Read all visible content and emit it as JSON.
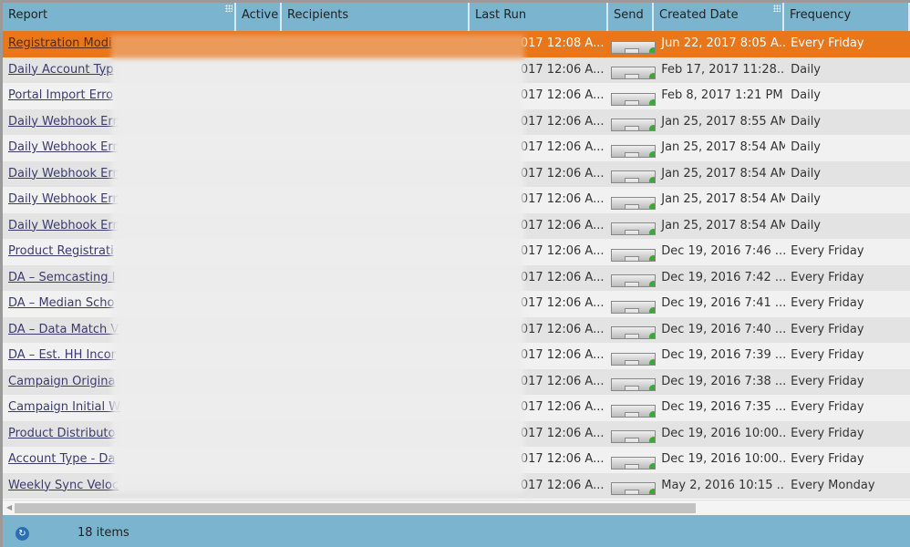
{
  "columns": [
    "Report",
    "Active",
    "Recipients",
    "Last Run",
    "Send",
    "Created Date",
    "Frequency"
  ],
  "rows": [
    {
      "report": "Registration Modi",
      "last_run": "017 12:08 A...",
      "created": "Jun 22, 2017 8:05 A...",
      "frequency": "Every Friday",
      "selected": true
    },
    {
      "report": "Daily Account Typ",
      "last_run": "017 12:06 A...",
      "created": "Feb 17, 2017 11:28...",
      "frequency": "Daily"
    },
    {
      "report": "Portal Import Erro",
      "last_run": "017 12:06 A...",
      "created": "Feb 8, 2017 1:21 PM",
      "frequency": "Daily"
    },
    {
      "report": "Daily Webhook Err",
      "last_run": "017 12:06 A...",
      "created": "Jan 25, 2017 8:55 AM",
      "frequency": "Daily"
    },
    {
      "report": "Daily Webhook Err",
      "last_run": "017 12:06 A...",
      "created": "Jan 25, 2017 8:54 AM",
      "frequency": "Daily"
    },
    {
      "report": "Daily Webhook Err",
      "last_run": "017 12:06 A...",
      "created": "Jan 25, 2017 8:54 AM",
      "frequency": "Daily"
    },
    {
      "report": "Daily Webhook Err",
      "last_run": "017 12:06 A...",
      "created": "Jan 25, 2017 8:54 AM",
      "frequency": "Daily"
    },
    {
      "report": "Daily Webhook Err",
      "last_run": "017 12:06 A...",
      "created": "Jan 25, 2017 8:54 AM",
      "frequency": "Daily"
    },
    {
      "report": "Product Registrati",
      "last_run": "017 12:06 A...",
      "created": "Dec 19, 2016 7:46 ...",
      "frequency": "Every Friday"
    },
    {
      "report": "DA – Semcasting I",
      "last_run": "017 12:06 A...",
      "created": "Dec 19, 2016 7:42 ...",
      "frequency": "Every Friday"
    },
    {
      "report": "DA – Median Scho",
      "last_run": "017 12:06 A...",
      "created": "Dec 19, 2016 7:41 ...",
      "frequency": "Every Friday"
    },
    {
      "report": "DA – Data Match V",
      "last_run": "017 12:06 A...",
      "created": "Dec 19, 2016 7:40 ...",
      "frequency": "Every Friday"
    },
    {
      "report": "DA – Est. HH Incor",
      "last_run": "017 12:06 A...",
      "created": "Dec 19, 2016 7:39 ...",
      "frequency": "Every Friday"
    },
    {
      "report": "Campaign Origina",
      "last_run": "017 12:06 A...",
      "created": "Dec 19, 2016 7:38 ...",
      "frequency": "Every Friday"
    },
    {
      "report": "Campaign Initial W",
      "last_run": "017 12:06 A...",
      "created": "Dec 19, 2016 7:35 ...",
      "frequency": "Every Friday"
    },
    {
      "report": "Product Distributo",
      "last_run": "017 12:06 A...",
      "created": "Dec 19, 2016 10:00...",
      "frequency": "Every Friday"
    },
    {
      "report": "Account Type - Da",
      "last_run": "017 12:06 A...",
      "created": "Dec 19, 2016 10:00...",
      "frequency": "Every Friday"
    },
    {
      "report": "Weekly Sync Veloc",
      "last_run": "017 12:06 A...",
      "created": "May 2, 2016 10:15 ...",
      "frequency": "Every Monday"
    }
  ],
  "footer": {
    "count": "18 items",
    "refresh_icon": "refresh-icon"
  },
  "colors": {
    "header": "#7ab4ce",
    "selected": "#e8771c"
  }
}
